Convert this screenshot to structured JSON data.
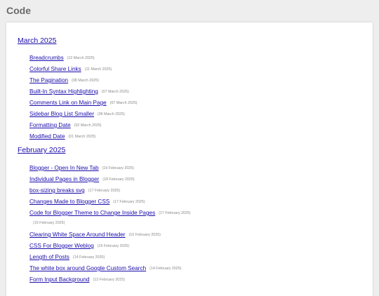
{
  "page": {
    "title": "Code"
  },
  "archive": {
    "march": {
      "heading": "March 2025",
      "posts": [
        {
          "title": "Breadcrumbs",
          "date": "(12 March 2025)"
        },
        {
          "title": "Colorful Share Links",
          "date": "(11 March 2025)"
        },
        {
          "title": "The Pagination",
          "date": "(08 March 2025)"
        },
        {
          "title": "Built-In Syntax Highlighting",
          "date": "(07 March 2025)"
        },
        {
          "title": "Comments Link on Main Page",
          "date": "(07 March 2025)"
        },
        {
          "title": "Sidebar Blog List Smaller",
          "date": "(06 March 2025)"
        },
        {
          "title": "Formatting Date",
          "date": "(02 March 2025)"
        },
        {
          "title": "Modified Date",
          "date": "(01 March 2025)"
        }
      ]
    },
    "february": {
      "heading": "February 2025",
      "posts": [
        {
          "title": "Blogger - Open In New Tab",
          "date": "(19 February 2025)"
        },
        {
          "title": "Individual Pages in Blogger",
          "date": "(18 February 2025)"
        },
        {
          "title": "box-sizing breaks svg",
          "date": "(17 February 2025)"
        },
        {
          "title": "Changes Made to Blogger CSS",
          "date": "(17 February 2025)"
        },
        {
          "title": "Code for Blogger Theme to Change Inside Pages",
          "date": "(17 February 2025)"
        },
        {
          "title": "Clearing White Space Around Header",
          "date": "(16 February 2025)"
        },
        {
          "title": "CSS For Blogger Weblog",
          "date": "(16 February 2025)"
        },
        {
          "title": "Length of Posts",
          "date": "(14 February 2025)"
        },
        {
          "title": "The white box around Google Custom Search",
          "date": "(14 February 2025)"
        },
        {
          "title": "Form Input Background",
          "date": "(13 February 2025)"
        }
      ],
      "wrapped_date": "(16 February 2025)"
    }
  }
}
